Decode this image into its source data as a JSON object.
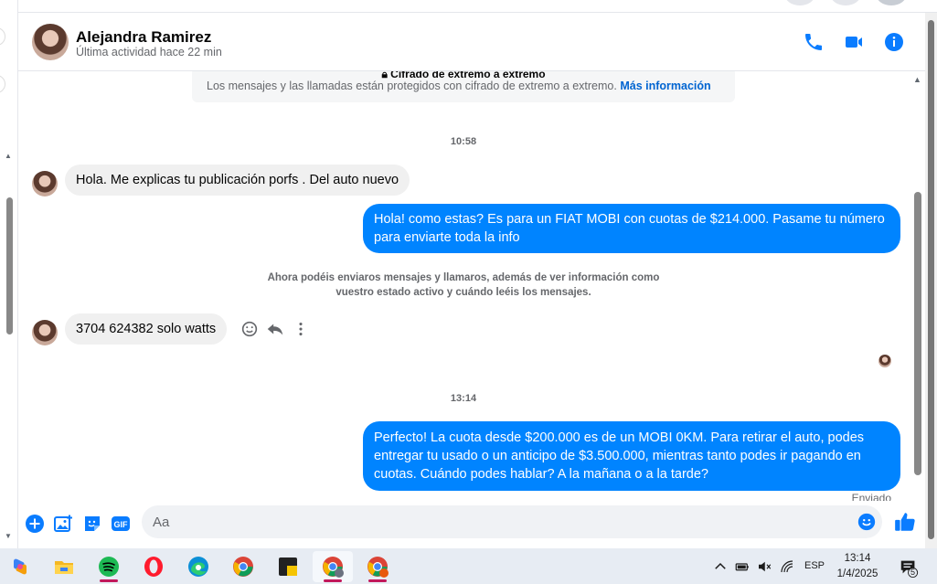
{
  "colors": {
    "accent": "#0084ff",
    "incoming_bubble": "#f0f0f0",
    "header_icons": "#0a7cff"
  },
  "contact": {
    "name": "Alejandra Ramirez",
    "status": "Última actividad hace 22 min"
  },
  "header_icons": [
    "phone-icon",
    "video-camera-icon",
    "info-icon"
  ],
  "encryption": {
    "title": "Cifrado de extremo a extremo",
    "body": "Los mensajes y las llamadas están protegidos con cifrado de extremo a extremo.",
    "link": "Más información"
  },
  "messages": {
    "time_1": "10:58",
    "in_1": "Hola. Me explicas tu publicación porfs . Del auto nuevo",
    "out_1": "Hola! como estas? Es para un FIAT MOBI con cuotas de $214.000. Pasame tu número para enviarte toda la info",
    "system_note": "Ahora podéis enviaros mensajes y llamaros, además de ver información como vuestro estado activo y cuándo leéis los mensajes.",
    "in_2": "3704 624382  solo watts",
    "time_2": "13:14",
    "out_2": "Perfecto! La cuota desde $200.000 es de un MOBI 0KM. Para retirar el auto, podes entregar tu usado o un anticipo de $3.500.000, mientras tanto podes ir pagando en cuotas. Cuándo podes hablar? A la mañana o a la tarde?",
    "sent_label": "Enviado"
  },
  "composer": {
    "placeholder": "Aa",
    "gif_label": "GIF"
  },
  "taskbar": {
    "apps": [
      "copilot-icon",
      "file-explorer-icon",
      "spotify-icon",
      "opera-icon",
      "edge-icon",
      "chrome-icon",
      "sticky-app-icon",
      "chrome-profile-icon",
      "chrome-profile-icon"
    ],
    "language": "ESP",
    "time": "13:14",
    "date": "1/4/2025",
    "notification_count": "5"
  }
}
